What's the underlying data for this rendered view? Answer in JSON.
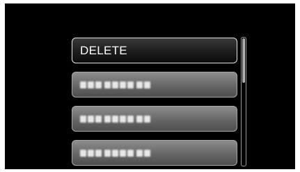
{
  "menu": {
    "selected_label": "DELETE",
    "items": [
      {
        "label": "DELETE",
        "selected": true
      },
      {
        "label": "",
        "selected": false,
        "obscured": true
      },
      {
        "label": "",
        "selected": false,
        "obscured": true
      },
      {
        "label": "",
        "selected": false,
        "obscured": true
      }
    ]
  },
  "scrollbar": {
    "position_fraction": 0.0,
    "visible_fraction": 0.35
  },
  "colors": {
    "screen_background": "#000000",
    "selected_item": "#1c1c1c",
    "inactive_item": "#666666",
    "text": "#ffffff"
  }
}
